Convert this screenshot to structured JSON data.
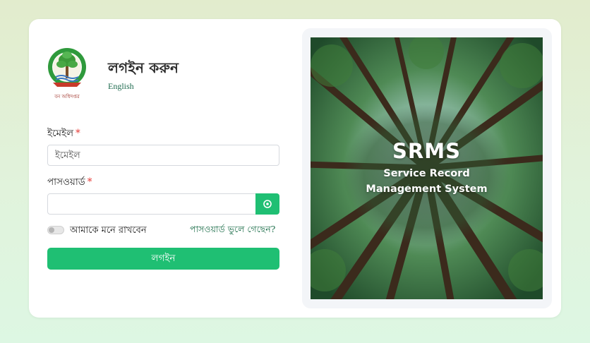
{
  "brand": {
    "logo_caption": "বন অধিদপ্তর"
  },
  "header": {
    "title": "লগইন করুন",
    "language_link": "English"
  },
  "form": {
    "email_label": "ইমেইল",
    "email_required": "*",
    "email_placeholder": "ইমেইল",
    "email_value": "",
    "password_label": "পাসওয়ার্ড",
    "password_required": "*",
    "password_value": "",
    "remember_label": "আমাকে মনে রাখবেন",
    "remember_checked": false,
    "forgot_link": "পাসওয়ার্ড ভুলে গেছেন?",
    "login_button": "লগইন"
  },
  "banner": {
    "title": "SRMS",
    "subtitle_line1": "Service Record",
    "subtitle_line2": "Management System"
  },
  "colors": {
    "accent": "#1fbf73",
    "link": "#1d6e4a",
    "required": "#e53935"
  },
  "icons": {
    "password_toggle": "eye-icon",
    "logo": "forest-department-logo"
  }
}
